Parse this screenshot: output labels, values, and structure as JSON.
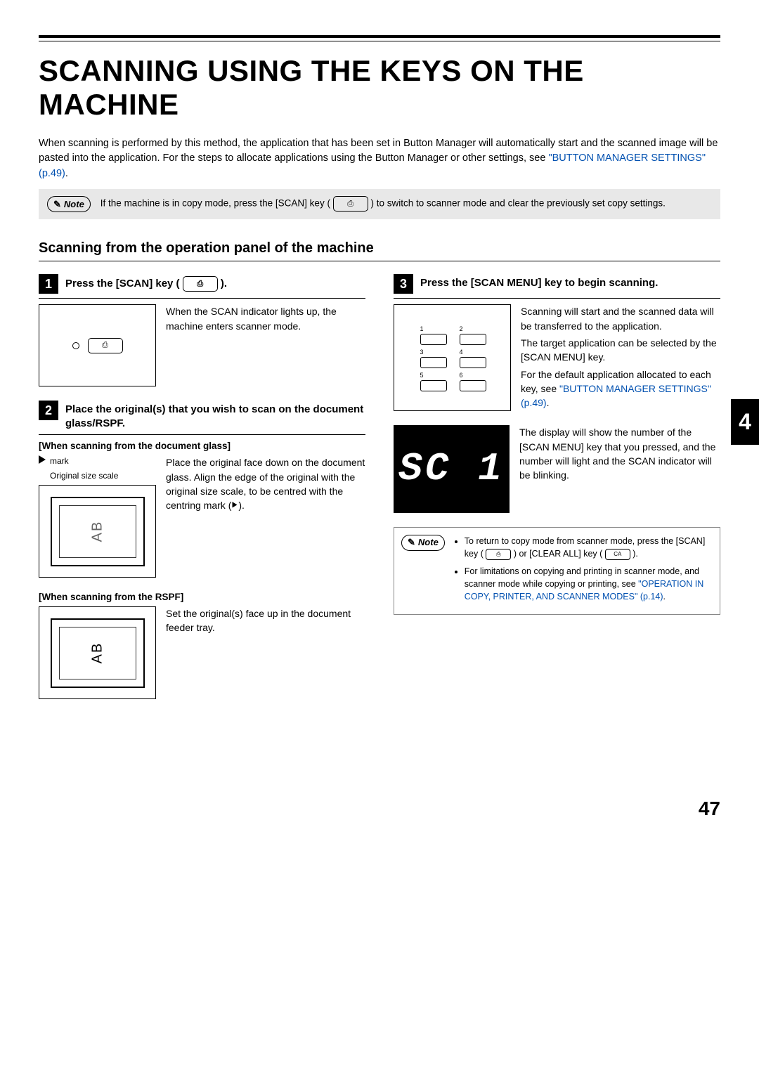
{
  "title": "SCANNING USING THE KEYS ON THE MACHINE",
  "intro": {
    "text": "When scanning is performed by this method, the application that has been set in Button Manager will automatically start and the scanned image will be pasted into the application. For the steps to allocate applications using the Button Manager or other settings, see ",
    "link": "\"BUTTON MANAGER SETTINGS\" (p.49)",
    "after": "."
  },
  "top_note": {
    "label": "Note",
    "before": "If the machine is in copy mode, press the [SCAN] key (",
    "after": ") to switch to scanner mode and clear the previously set copy settings."
  },
  "subtitle": "Scanning from the operation panel of the machine",
  "step1": {
    "num": "1",
    "title_before": "Press the [SCAN] key (",
    "title_after": ").",
    "body": "When the SCAN indicator lights up, the machine enters scanner mode."
  },
  "step2": {
    "num": "2",
    "title": "Place the original(s) that you wish to scan on the document glass/RSPF.",
    "glass_head": "[When scanning from the document glass]",
    "mark_label": "mark",
    "scale_label": "Original size scale",
    "glass_body_before": "Place the original face down on the document glass. Align the edge of the original with the original size scale, to be centred with the centring mark (",
    "glass_body_after": ").",
    "rspf_head": "[When scanning from the RSPF]",
    "rspf_body": "Set the original(s) face up in the document feeder tray.",
    "ab_text": "AB"
  },
  "step3": {
    "num": "3",
    "title": "Press the [SCAN MENU] key to begin scanning.",
    "p1": "Scanning will start and the scanned data will be transferred to the application.",
    "p2": "The target application can be selected by the [SCAN MENU] key.",
    "p3_before": "For the default application allocated to each key, see ",
    "p3_link": "\"BUTTON MANAGER SETTINGS\" (p.49)",
    "p3_after": ".",
    "p4": "The display will show the number of the [SCAN MENU] key that you pressed, and the number will light and the SCAN indicator will be blinking.",
    "display_text": "SC 1",
    "keypad": [
      "1",
      "2",
      "3",
      "4",
      "5",
      "6"
    ]
  },
  "bottom_note": {
    "label": "Note",
    "li1_before": "To return to copy mode from scanner mode, press the [SCAN] key (",
    "li1_mid": ") or [CLEAR ALL] key (",
    "li1_ca": "CA",
    "li1_after": ").",
    "li2_before": "For limitations on copying and printing in scanner mode, and scanner mode while copying or printing, see ",
    "li2_link": "\"OPERATION IN COPY, PRINTER, AND SCANNER MODES\" (p.14)",
    "li2_after": "."
  },
  "side_tab": "4",
  "page_number": "47"
}
